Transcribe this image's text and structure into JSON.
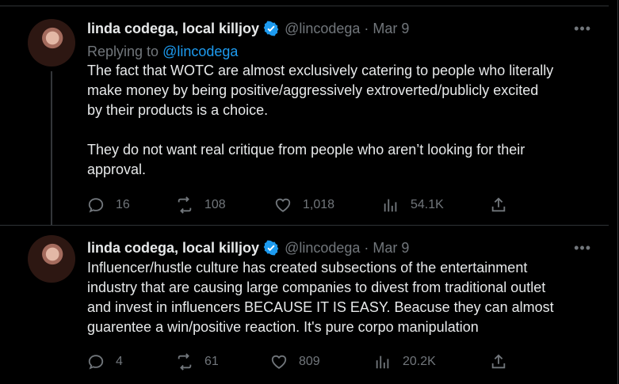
{
  "tweets": [
    {
      "author_name": "linda codega, local killjoy",
      "handle": "@lincodega",
      "separator": "·",
      "date": "Mar 9",
      "more_label": "•••",
      "replying_prefix": "Replying to ",
      "replying_handle": "@lincodega",
      "text": "The fact that WOTC are almost exclusively catering to people who literally\nmake money by being positive/aggressively extroverted/publicly excited\nby their products is a choice.\n\nThey do not want real critique from people who aren’t looking for their\napproval.",
      "replies": "16",
      "reposts": "108",
      "likes": "1,018",
      "views": "54.1K"
    },
    {
      "author_name": "linda codega, local killjoy",
      "handle": "@lincodega",
      "separator": "·",
      "date": "Mar 9",
      "more_label": "•••",
      "text": "Influencer/hustle culture has created subsections of the entertainment\nindustry that are causing large companies to divest from traditional outlet\nand invest in influencers BECAUSE IT IS EASY. Beacuse they can almost\nguarentee a win/positive reaction. It's pure corpo manipulation",
      "replies": "4",
      "reposts": "61",
      "likes": "809",
      "views": "20.2K"
    }
  ],
  "colors": {
    "background": "#000000",
    "text_primary": "#e7e9ea",
    "text_secondary": "#71767b",
    "accent_blue": "#1d9bf0",
    "divider": "#2f3336"
  },
  "icons": [
    "verified-badge-icon",
    "more-icon",
    "reply-icon",
    "repost-icon",
    "like-icon",
    "views-icon",
    "share-icon"
  ]
}
